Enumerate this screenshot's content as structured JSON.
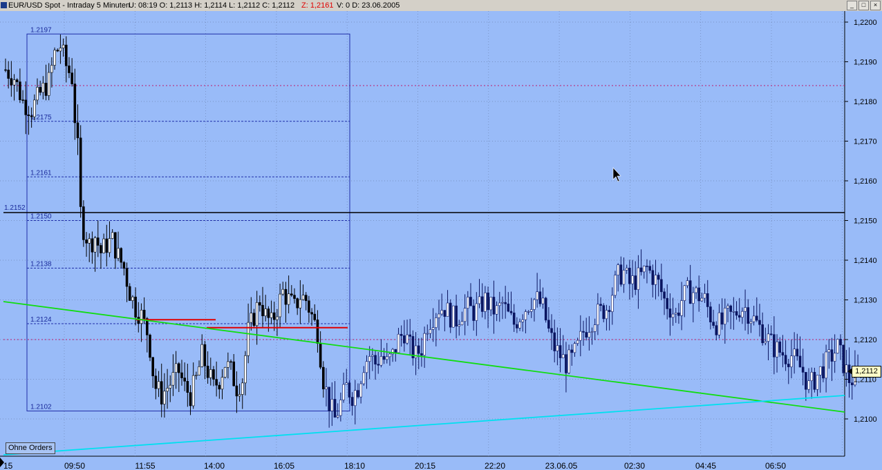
{
  "window": {
    "title": "EUR/USD Spot - Intraday 5 Minuten",
    "ohlc": "U: 08:19  O: 1,2113  H: 1,2114  L: 1,2112  C: 1,2112",
    "z_value": "Z: 1,2161",
    "volume_date": "V: 0  D: 23.06.2005",
    "buttons": [
      "_",
      "□",
      "×"
    ]
  },
  "overlay": {
    "ohne_orders": "Ohne Orders",
    "last_price": "1,2112"
  },
  "colors": {
    "background": "#99bbf8",
    "axis_background": "#99bbf8",
    "grid": "#6f86b4",
    "candle": "#000000",
    "candle_later": "#0a1560",
    "fib_box": "#1f2ea8",
    "support_line": "#000000",
    "resistance_dotted": "#c0186c",
    "red_levels": "#e00000",
    "green_trend": "#10dd10",
    "cyan_trend": "#00e0f0"
  },
  "chart_data": {
    "type": "candlestick",
    "title": "EUR/USD Spot - Intraday 5 Minuten",
    "ylim": [
      1.2091,
      1.2203
    ],
    "y_ticks": [
      "1,2100",
      "1,2110",
      "1,2120",
      "1,2130",
      "1,2140",
      "1,2150",
      "1,2160",
      "1,2170",
      "1,2180",
      "1,2190",
      "1,2200"
    ],
    "x_tick_labels": [
      "15",
      "09:50",
      "11:55",
      "14:00",
      "16:05",
      "18:10",
      "20:15",
      "22:20",
      "23.06.05",
      "02:30",
      "04:45",
      "06:50"
    ],
    "grid": true,
    "fib_levels": [
      1.2197,
      1.2175,
      1.2161,
      1.215,
      1.2138,
      1.2124,
      1.2102
    ],
    "fib_labels": [
      "1.2197",
      "1.2175",
      "1.2161",
      "1.2150",
      "1.2138",
      "1.2124",
      "1.2102"
    ],
    "horizontal_line": {
      "value": 1.2152,
      "label": "1.2152"
    },
    "dotted_resistance": [
      1.2184,
      1.212
    ],
    "red_levels": [
      1.2125,
      1.2123
    ],
    "last_price": 1.2112,
    "close_path": [
      [
        0,
        1.2188
      ],
      [
        3,
        1.2186
      ],
      [
        6,
        1.218
      ],
      [
        9,
        1.2178
      ],
      [
        12,
        1.2182
      ],
      [
        15,
        1.2185
      ],
      [
        17,
        1.2192
      ],
      [
        19,
        1.2194
      ],
      [
        21,
        1.2189
      ],
      [
        23,
        1.2186
      ],
      [
        24,
        1.2176
      ],
      [
        25,
        1.2168
      ],
      [
        26,
        1.2152
      ],
      [
        27,
        1.2148
      ],
      [
        29,
        1.2144
      ],
      [
        31,
        1.2146
      ],
      [
        33,
        1.2142
      ],
      [
        35,
        1.2144
      ],
      [
        37,
        1.2145
      ],
      [
        39,
        1.2141
      ],
      [
        41,
        1.2138
      ],
      [
        43,
        1.2132
      ],
      [
        45,
        1.2128
      ],
      [
        47,
        1.2126
      ],
      [
        49,
        1.2122
      ],
      [
        50,
        1.2118
      ],
      [
        51,
        1.2112
      ],
      [
        52,
        1.2108
      ],
      [
        54,
        1.2106
      ],
      [
        56,
        1.2108
      ],
      [
        58,
        1.211
      ],
      [
        60,
        1.2112
      ],
      [
        62,
        1.2108
      ],
      [
        64,
        1.2106
      ],
      [
        66,
        1.211
      ],
      [
        68,
        1.2116
      ],
      [
        70,
        1.2112
      ],
      [
        72,
        1.2108
      ],
      [
        74,
        1.211
      ],
      [
        76,
        1.2114
      ],
      [
        78,
        1.2112
      ],
      [
        80,
        1.2108
      ],
      [
        82,
        1.211
      ],
      [
        84,
        1.2122
      ],
      [
        86,
        1.2126
      ],
      [
        88,
        1.213
      ],
      [
        90,
        1.2126
      ],
      [
        92,
        1.2124
      ],
      [
        94,
        1.2128
      ],
      [
        96,
        1.2132
      ],
      [
        98,
        1.213
      ],
      [
        100,
        1.2128
      ],
      [
        102,
        1.2131
      ],
      [
        104,
        1.213
      ],
      [
        106,
        1.2126
      ],
      [
        108,
        1.2122
      ],
      [
        110,
        1.211
      ],
      [
        112,
        1.2104
      ],
      [
        114,
        1.21
      ],
      [
        116,
        1.2104
      ],
      [
        118,
        1.2108
      ],
      [
        120,
        1.2106
      ],
      [
        122,
        1.2108
      ],
      [
        124,
        1.2114
      ],
      [
        126,
        1.2116
      ],
      [
        128,
        1.2114
      ],
      [
        130,
        1.2116
      ],
      [
        132,
        1.2114
      ],
      [
        134,
        1.2116
      ],
      [
        136,
        1.212
      ],
      [
        138,
        1.2122
      ],
      [
        140,
        1.2118
      ],
      [
        142,
        1.2116
      ],
      [
        144,
        1.2118
      ],
      [
        146,
        1.2124
      ],
      [
        148,
        1.2126
      ],
      [
        150,
        1.2128
      ],
      [
        152,
        1.2128
      ],
      [
        154,
        1.2126
      ],
      [
        156,
        1.2125
      ],
      [
        158,
        1.2127
      ],
      [
        160,
        1.2128
      ],
      [
        162,
        1.2127
      ],
      [
        164,
        1.2128
      ],
      [
        166,
        1.213
      ],
      [
        168,
        1.2128
      ],
      [
        170,
        1.2127
      ],
      [
        172,
        1.2129
      ],
      [
        174,
        1.2126
      ],
      [
        176,
        1.2124
      ],
      [
        178,
        1.2126
      ],
      [
        180,
        1.2128
      ],
      [
        182,
        1.213
      ],
      [
        184,
        1.213
      ],
      [
        186,
        1.2128
      ],
      [
        188,
        1.2122
      ],
      [
        190,
        1.2118
      ],
      [
        192,
        1.2116
      ],
      [
        194,
        1.2114
      ],
      [
        196,
        1.2115
      ],
      [
        198,
        1.2118
      ],
      [
        200,
        1.2122
      ],
      [
        202,
        1.2124
      ],
      [
        204,
        1.2126
      ],
      [
        206,
        1.2127
      ],
      [
        208,
        1.2128
      ],
      [
        210,
        1.2132
      ],
      [
        212,
        1.2136
      ],
      [
        214,
        1.2137
      ],
      [
        216,
        1.2134
      ],
      [
        218,
        1.2135
      ],
      [
        220,
        1.2136
      ],
      [
        222,
        1.2138
      ],
      [
        224,
        1.2136
      ],
      [
        226,
        1.2134
      ],
      [
        228,
        1.213
      ],
      [
        230,
        1.2128
      ],
      [
        232,
        1.2126
      ],
      [
        234,
        1.213
      ],
      [
        236,
        1.2132
      ],
      [
        238,
        1.2132
      ],
      [
        240,
        1.2131
      ],
      [
        242,
        1.213
      ],
      [
        244,
        1.2126
      ],
      [
        246,
        1.2124
      ],
      [
        248,
        1.2124
      ],
      [
        250,
        1.2126
      ],
      [
        252,
        1.2126
      ],
      [
        254,
        1.2128
      ],
      [
        256,
        1.2128
      ],
      [
        258,
        1.2126
      ],
      [
        260,
        1.2124
      ],
      [
        262,
        1.2122
      ],
      [
        264,
        1.212
      ],
      [
        266,
        1.2118
      ],
      [
        268,
        1.2117
      ],
      [
        270,
        1.2116
      ],
      [
        272,
        1.2116
      ],
      [
        274,
        1.2114
      ],
      [
        276,
        1.2112
      ],
      [
        278,
        1.2108
      ],
      [
        280,
        1.211
      ],
      [
        282,
        1.2112
      ],
      [
        284,
        1.2114
      ],
      [
        286,
        1.2116
      ],
      [
        288,
        1.2118
      ],
      [
        290,
        1.2114
      ],
      [
        292,
        1.211
      ],
      [
        294,
        1.211
      ],
      [
        296,
        1.2112
      ]
    ]
  }
}
